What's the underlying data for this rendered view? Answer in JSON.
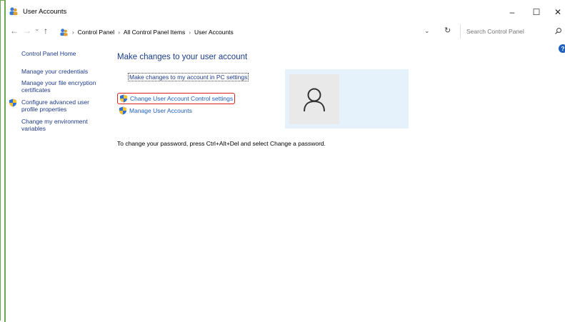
{
  "window": {
    "title": "User Accounts",
    "minimize": "–",
    "maximize": "☐",
    "close": "✕"
  },
  "address": {
    "back": "←",
    "forward": "→",
    "recent": "⌄",
    "up": "↑",
    "sep": "›",
    "crumbs": [
      "Control Panel",
      "All Control Panel Items",
      "User Accounts"
    ],
    "dropdown": "⌄",
    "refresh": "↻"
  },
  "search": {
    "placeholder": "Search Control Panel"
  },
  "help": {
    "label": "?"
  },
  "nav": {
    "home": "Control Panel Home",
    "credentials": "Manage your credentials",
    "encryption": "Manage your file encryption certificates",
    "advanced": "Configure advanced user profile properties",
    "environment": "Change my environment variables"
  },
  "main": {
    "heading": "Make changes to your user account",
    "pc_settings_link": "Make changes to my account in PC settings",
    "uac_link": "Change User Account Control settings",
    "manage_link": "Manage User Accounts",
    "password_text": "To change your password, press Ctrl+Alt+Del and select Change a password."
  },
  "icons": {
    "app": "users-icon",
    "shield": "uac-shield-icon",
    "avatar": "user-avatar-icon",
    "search": "search-icon"
  },
  "colors": {
    "link": "#1e5fbf",
    "heading": "#1a3d8a",
    "highlight": "#e0201e",
    "panel": "#e5f1fb"
  }
}
